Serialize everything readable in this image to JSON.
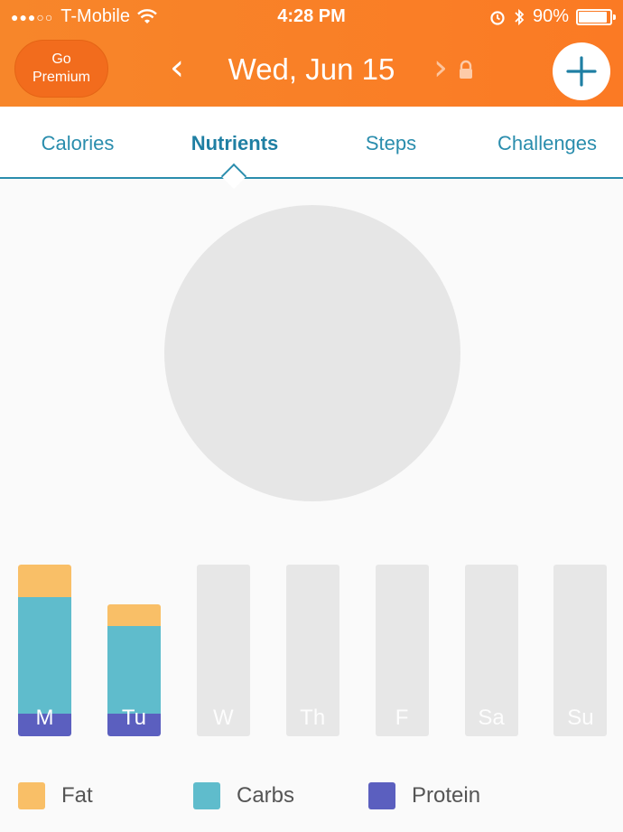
{
  "status": {
    "carrier": "T-Mobile",
    "time": "4:28 PM",
    "battery": "90%",
    "battery_level": 0.9
  },
  "header": {
    "premium_line1": "Go",
    "premium_line2": "Premium",
    "date": "Wed, Jun 15",
    "prev_glyph": "‹",
    "next_glyph": "›"
  },
  "tabs": [
    {
      "label": "Calories"
    },
    {
      "label": "Nutrients"
    },
    {
      "label": "Steps"
    },
    {
      "label": "Challenges"
    }
  ],
  "colors": {
    "accent": "#f7862a",
    "tab": "#2a8dad",
    "fat": "#f9bf67",
    "carbs": "#5fbccc",
    "protein": "#5b5fbf",
    "empty": "#e7e7e7"
  },
  "chart_data": {
    "type": "bar",
    "categories": [
      "M",
      "Tu",
      "W",
      "Th",
      "F",
      "Sa",
      "Su"
    ],
    "series": [
      {
        "name": "Fat",
        "values": [
          0.19,
          0.13,
          0,
          0,
          0,
          0,
          0
        ]
      },
      {
        "name": "Carbs",
        "values": [
          0.68,
          0.51,
          0,
          0,
          0,
          0,
          0
        ]
      },
      {
        "name": "Protein",
        "values": [
          0.13,
          0.13,
          0,
          0,
          0,
          0,
          0
        ]
      }
    ]
  },
  "legend": [
    {
      "label": "Fat"
    },
    {
      "label": "Carbs"
    },
    {
      "label": "Protein"
    }
  ]
}
